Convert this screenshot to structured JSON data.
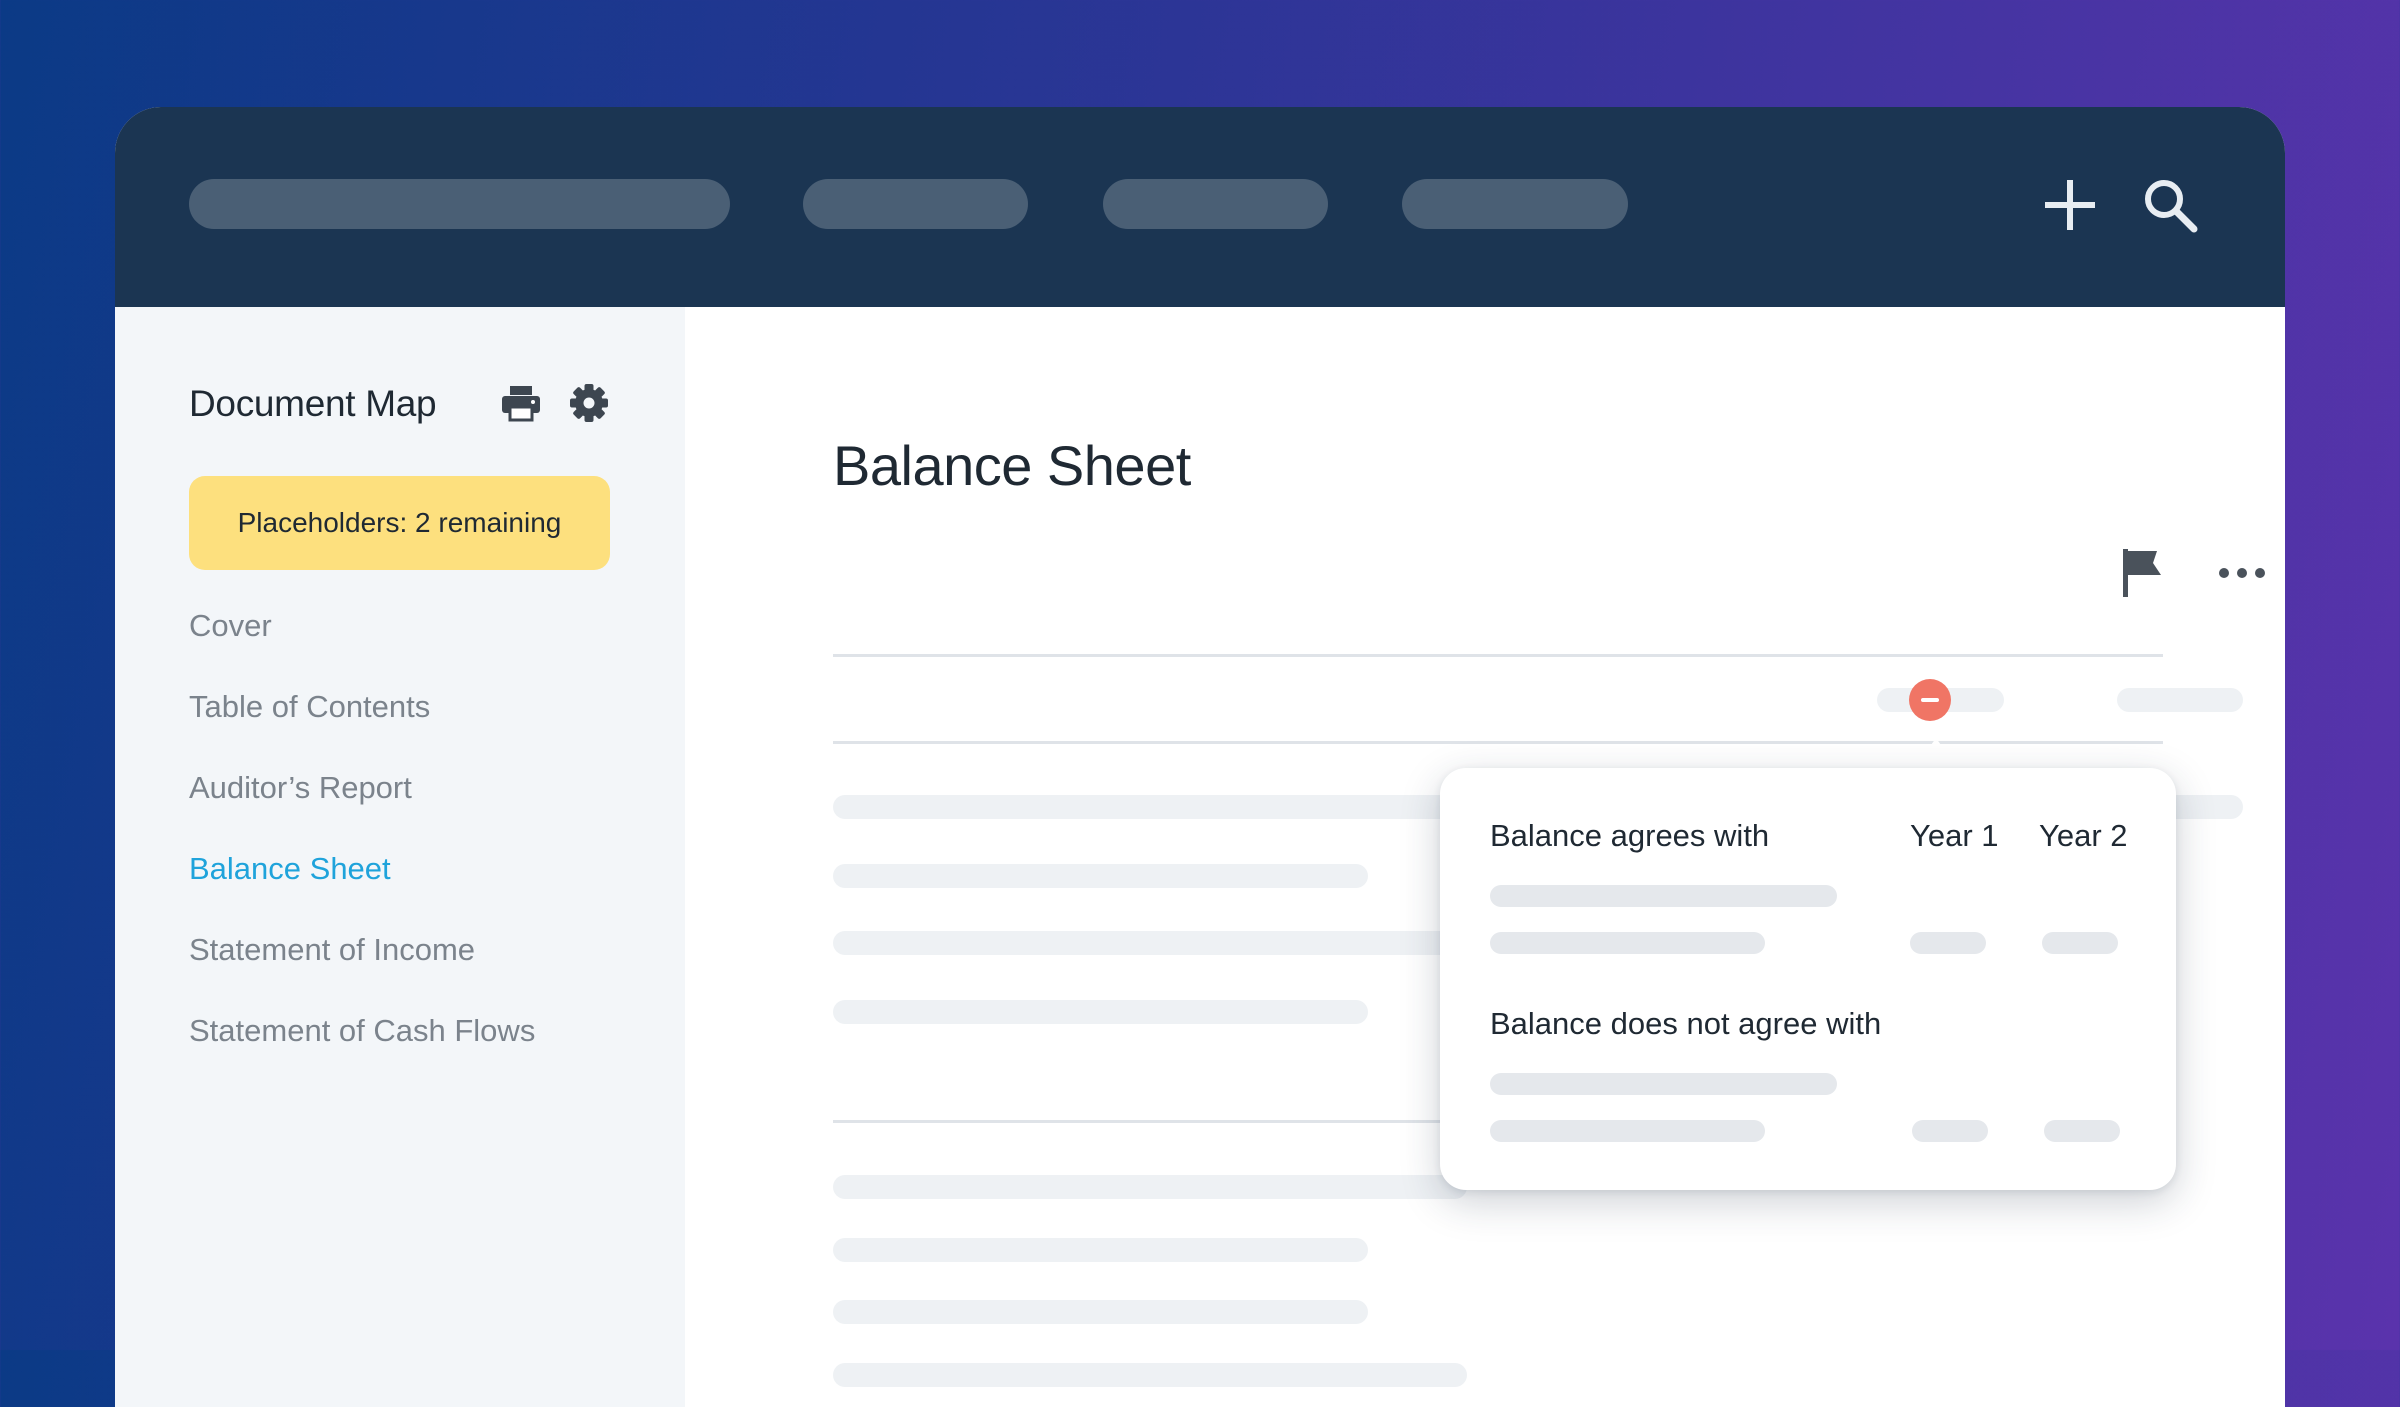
{
  "toolbar": {
    "add_icon": "plus-icon",
    "search_icon": "search-icon"
  },
  "sidebar": {
    "title": "Document Map",
    "print_icon": "printer-icon",
    "settings_icon": "gear-icon",
    "placeholder_badge": "Placeholders: 2 remaining",
    "items": [
      {
        "label": "Cover",
        "active": false
      },
      {
        "label": "Table of Contents",
        "active": false
      },
      {
        "label": "Auditor’s Report",
        "active": false
      },
      {
        "label": "Balance Sheet",
        "active": true
      },
      {
        "label": "Statement of Income",
        "active": false
      },
      {
        "label": "Statement of Cash Flows",
        "active": false
      }
    ]
  },
  "main": {
    "title": "Balance Sheet",
    "flag_icon": "flag-icon",
    "more_icon": "more-horizontal-icon",
    "alert_icon": "minus-circle-icon"
  },
  "popover": {
    "agrees_heading": "Balance agrees with",
    "col_year1": "Year 1",
    "col_year2": "Year 2",
    "disagrees_heading": "Balance does not agree with"
  },
  "colors": {
    "topbar": "#1b3552",
    "sidebar": "#f3f6f9",
    "badge": "#fde07e",
    "active_link": "#1fa3db",
    "alert": "#f07565"
  }
}
